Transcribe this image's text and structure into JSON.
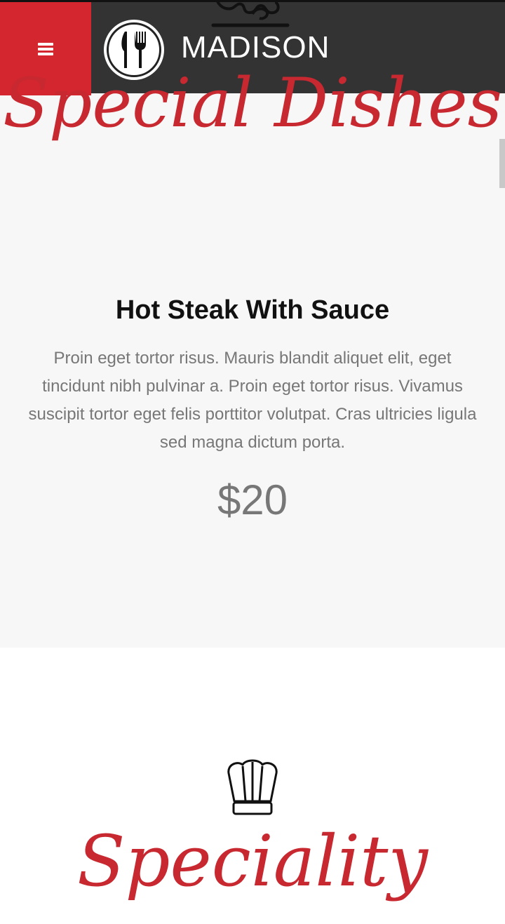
{
  "header": {
    "brand": "MADISON",
    "menu_icon": "hamburger-icon",
    "logo_icon": "fork-knife-icon"
  },
  "special_section": {
    "title": "Special Dishes",
    "dish": {
      "name": "Hot Steak With Sauce",
      "description": "Proin eget tortor risus. Mauris blandit aliquet elit, eget tincidunt nibh pulvinar a. Proin eget tortor risus. Vivamus suscipit tortor eget felis porttitor volutpat. Cras ultricies ligula sed magna dictum porta.",
      "price": "$20"
    }
  },
  "speciality_section": {
    "icon": "chef-hat-icon",
    "title": "Speciality"
  },
  "colors": {
    "accent": "#d4262f",
    "header_bg": "#333333",
    "section_bg": "#f7f7f7"
  }
}
